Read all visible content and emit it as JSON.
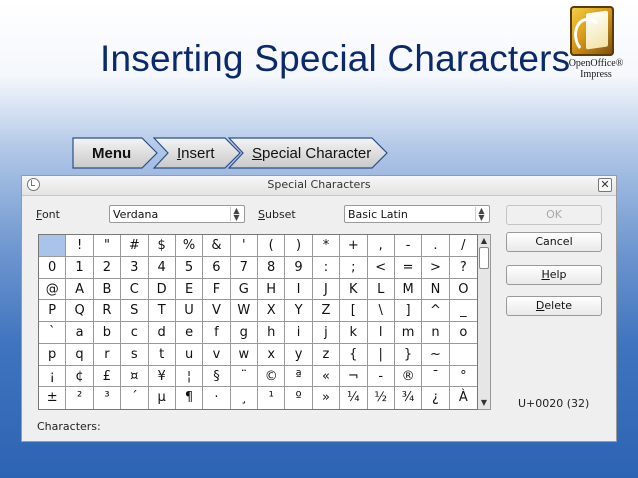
{
  "slide": {
    "title": "Inserting Special Characters"
  },
  "logo": {
    "line1": "OpenOffice®",
    "line2": "Impress"
  },
  "breadcrumb": [
    {
      "pre": "",
      "key": "",
      "label": "Menu"
    },
    {
      "pre": "",
      "key": "I",
      "label": "nsert"
    },
    {
      "pre": "",
      "key": "S",
      "label": "pecial Character"
    }
  ],
  "dialog": {
    "title": "Special Characters",
    "close": "✕",
    "font_label_key": "F",
    "font_label_rest": "ont",
    "font_value": "Verdana",
    "subset_label_key": "S",
    "subset_label_rest": "ubset",
    "subset_value": "Basic Latin",
    "ok_label": "OK",
    "cancel_label": "Cancel",
    "help_key": "H",
    "help_rest": "elp",
    "delete_key": "D",
    "delete_rest": "elete",
    "unicode_readout": "U+0020 (32)",
    "characters_label": "Characters:",
    "grid_rows": [
      [
        " ",
        "!",
        "\"",
        "#",
        "$",
        "%",
        "&",
        "'",
        "(",
        ")",
        "*",
        "+",
        ",",
        "-",
        ".",
        "/"
      ],
      [
        "0",
        "1",
        "2",
        "3",
        "4",
        "5",
        "6",
        "7",
        "8",
        "9",
        ":",
        ";",
        "<",
        "=",
        ">",
        "?"
      ],
      [
        "@",
        "A",
        "B",
        "C",
        "D",
        "E",
        "F",
        "G",
        "H",
        "I",
        "J",
        "K",
        "L",
        "M",
        "N",
        "O"
      ],
      [
        "P",
        "Q",
        "R",
        "S",
        "T",
        "U",
        "V",
        "W",
        "X",
        "Y",
        "Z",
        "[",
        "\\",
        "]",
        "^",
        "_"
      ],
      [
        "`",
        "a",
        "b",
        "c",
        "d",
        "e",
        "f",
        "g",
        "h",
        "i",
        "j",
        "k",
        "l",
        "m",
        "n",
        "o"
      ],
      [
        "p",
        "q",
        "r",
        "s",
        "t",
        "u",
        "v",
        "w",
        "x",
        "y",
        "z",
        "{",
        "|",
        "}",
        "~",
        ""
      ],
      [
        "¡",
        "¢",
        "£",
        "¤",
        "¥",
        "¦",
        "§",
        "¨",
        "©",
        "ª",
        "«",
        "¬",
        "-",
        "®",
        "¯",
        "°"
      ],
      [
        "±",
        "²",
        "³",
        "´",
        "µ",
        "¶",
        "·",
        "¸",
        "¹",
        "º",
        "»",
        "¼",
        "½",
        "¾",
        "¿",
        "À"
      ]
    ],
    "selected_cell": [
      0,
      0
    ]
  }
}
